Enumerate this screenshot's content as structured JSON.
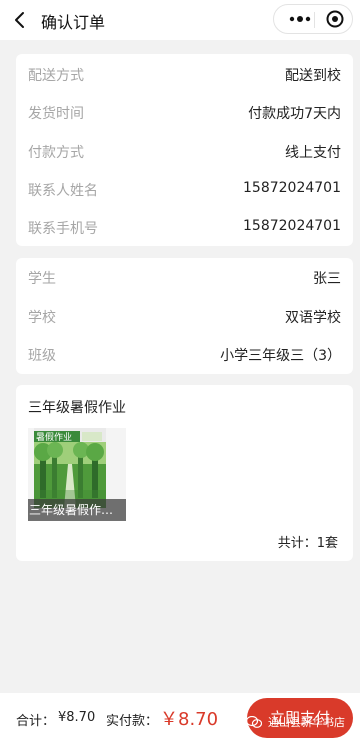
{
  "nav": {
    "title": "确认订单"
  },
  "delivery": {
    "rows": [
      {
        "label": "配送方式",
        "value": "配送到校"
      },
      {
        "label": "发货时间",
        "value": "付款成功7天内"
      },
      {
        "label": "付款方式",
        "value": "线上支付"
      },
      {
        "label": "联系人姓名",
        "value": "15872024701"
      },
      {
        "label": "联系手机号",
        "value": "15872024701"
      }
    ]
  },
  "student": {
    "rows": [
      {
        "label": "学生",
        "value": "张三"
      },
      {
        "label": "学校",
        "value": "双语学校"
      },
      {
        "label": "班级",
        "value": "小学三年级三（3）"
      }
    ]
  },
  "product": {
    "title": "三年级暑假作业",
    "thumb_caption": "三年级暑假作…",
    "cover_text": "暑假作业",
    "total": "共计：1套"
  },
  "bottom": {
    "sum_label": "合计：",
    "sum_value": "¥8.70",
    "pay_label": "实付款：",
    "pay_value": "￥8.70",
    "pay_button": "立即支付"
  },
  "watermark": "通山县新华书店",
  "colors": {
    "accent": "#d93a2a",
    "background": "#f2f2f2",
    "label_gray": "#a6a6a6"
  }
}
